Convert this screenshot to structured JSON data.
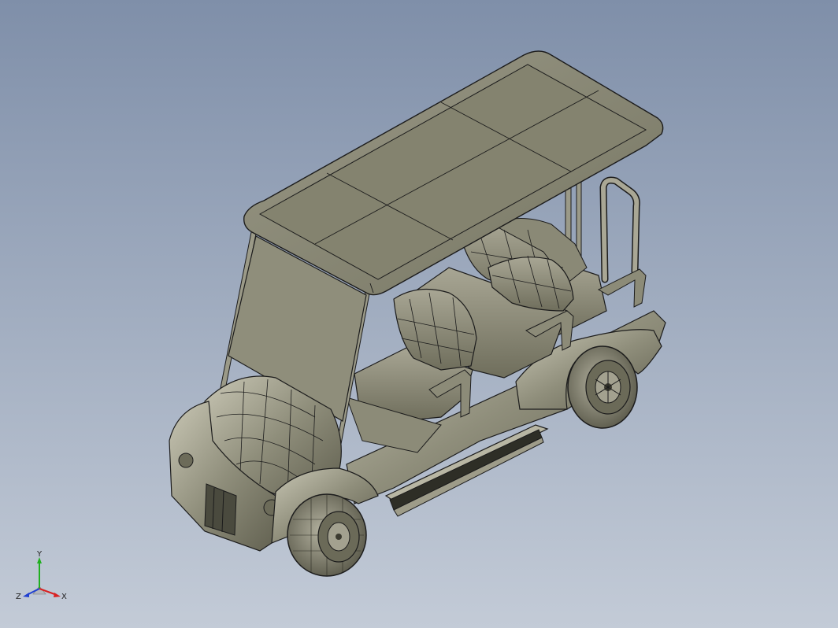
{
  "viewport": {
    "background_top": "#7f8fa9",
    "background_bottom": "#c3cbd7"
  },
  "model": {
    "part_color": "#8c8b78",
    "part_highlight": "#bdbba8",
    "edge_color": "#1c1c1c"
  },
  "triad": {
    "x_label": "X",
    "y_label": "Y",
    "z_label": "Z",
    "x_color": "#d92020",
    "y_color": "#20b020",
    "z_color": "#2040d0"
  }
}
